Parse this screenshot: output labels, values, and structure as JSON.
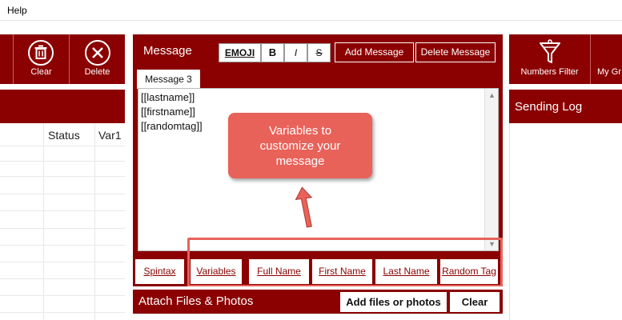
{
  "menu": {
    "help": "Help"
  },
  "toolbar": {
    "clear_label": "Clear",
    "delete_label": "Delete"
  },
  "table": {
    "col_status": "Status",
    "col_var1": "Var1"
  },
  "message": {
    "title": "Message",
    "emoji_label": "EMOJI",
    "bold_label": "B",
    "italic_label": "I",
    "strike_label": "S",
    "add_label": "Add Message",
    "delete_label": "Delete Message",
    "tab_label": "Message 3",
    "lines": [
      "[[lastname]]",
      "[[firstname]]",
      "[[randomtag]]"
    ]
  },
  "callout": {
    "text": "Variables to customize your message",
    "color": "#e8625a"
  },
  "variables": {
    "spintax": "Spintax",
    "variables": "Variables",
    "full_name": "Full Name",
    "first_name": "First Name",
    "last_name": "Last Name",
    "random_tag": "Random Tag"
  },
  "attach": {
    "title": "Attach Files & Photos",
    "add_label": "Add files or photos",
    "clear_label": "Clear"
  },
  "right": {
    "numbers_filter": "Numbers Filter",
    "my_group": "My Gr",
    "sending_log": "Sending Log"
  },
  "colors": {
    "brand": "#8b0000",
    "highlight": "#e8625a"
  }
}
